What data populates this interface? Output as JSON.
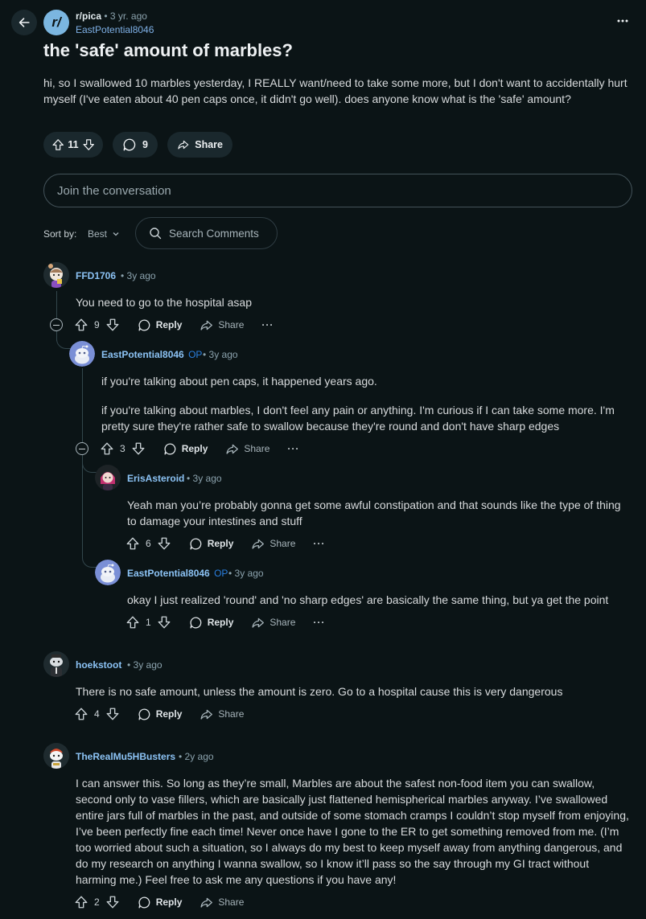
{
  "post": {
    "subreddit": "r/pica",
    "time": "3 yr. ago",
    "author": "EastPotential8046",
    "title": "the 'safe' amount of marbles?",
    "body": "hi, so I swallowed 10 marbles yesterday, I REALLY want/need to take some more, but I don't want to accidentally hurt myself (I've eaten about 40 pen caps once, it didn't go well). does anyone know what is the 'safe' amount?",
    "votes": "11",
    "comments": "9",
    "share_label": "Share",
    "sub_icon_text": "r/"
  },
  "composer": {
    "placeholder": "Join the conversation"
  },
  "sort": {
    "label": "Sort by:",
    "value": "Best",
    "search_placeholder": "Search Comments"
  },
  "labels": {
    "reply": "Reply",
    "share": "Share",
    "more": "···",
    "op": "OP"
  },
  "comments": [
    {
      "author": "FFD1706",
      "time": "• 3y ago",
      "body": "You need to go to the hospital asap",
      "votes": "9"
    },
    {
      "author": "EastPotential8046",
      "time": "• 3y ago",
      "body": "if you're talking about pen caps, it happened years ago.",
      "body2": "if you're talking about marbles, I don't feel any pain or anything. I'm curious if I can take some more. I'm pretty sure they're rather safe to swallow because they're round and don't have sharp edges",
      "votes": "3"
    },
    {
      "author": "ErisAsteroid",
      "time": "• 3y ago",
      "body": "Yeah man you’re probably gonna get some awful constipation and that sounds like the type of thing to damage your intestines and stuff",
      "votes": "6"
    },
    {
      "author": "EastPotential8046",
      "time": "• 3y ago",
      "body": "okay I just realized 'round' and 'no sharp edges' are basically the same thing, but ya get the point",
      "votes": "1"
    },
    {
      "author": "hoekstoot",
      "time": "• 3y ago",
      "body": "There is no safe amount, unless the amount is zero. Go to a hospital cause this is very dangerous",
      "votes": "4"
    },
    {
      "author": "TheRealMu5HBusters",
      "time": "• 2y ago",
      "body": "I can answer this. So long as they’re small, Marbles are about the safest non-food item you can swallow, second only to vase fillers, which are basically just flattened hemispherical marbles anyway. I’ve swallowed entire jars full of marbles in the past, and outside of some stomach cramps I couldn’t stop myself from enjoying, I’ve been perfectly fine each time! Never once have I gone to the ER to get something removed from me. (I’m too worried about such a situation, so I always do my best to keep myself away from anything dangerous, and do my research on anything I wanna swallow, so I know it’ll pass so the say through my GI tract without harming me.) Feel free to ask me any questions if you have any!",
      "votes": "2"
    }
  ]
}
